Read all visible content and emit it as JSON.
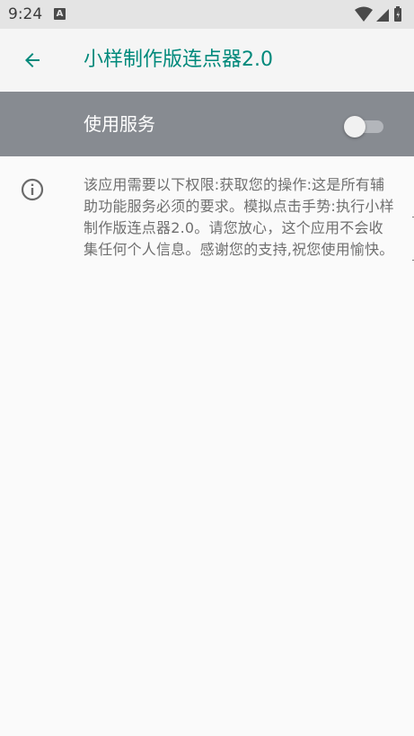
{
  "status_bar": {
    "time": "9:24",
    "notification_icon": "a-icon",
    "notification_letter": "A",
    "icons": [
      "wifi-icon",
      "signal-icon",
      "battery-icon"
    ]
  },
  "toolbar": {
    "back_icon": "arrow-left-icon",
    "title": "小样制作版连点器2.0",
    "title_color": "#00897b"
  },
  "service_switch": {
    "label": "使用服务",
    "state": "off",
    "bar_color": "#878b91"
  },
  "info": {
    "icon": "info-icon",
    "description": "该应用需要以下权限:获取您的操作:这是所有辅助功能服务必须的要求。模拟点击手势:执行小样制作版连点器2.0。请您放心，这个应用不会收集任何个人信息。感谢您的支持,祝您使用愉快。"
  }
}
